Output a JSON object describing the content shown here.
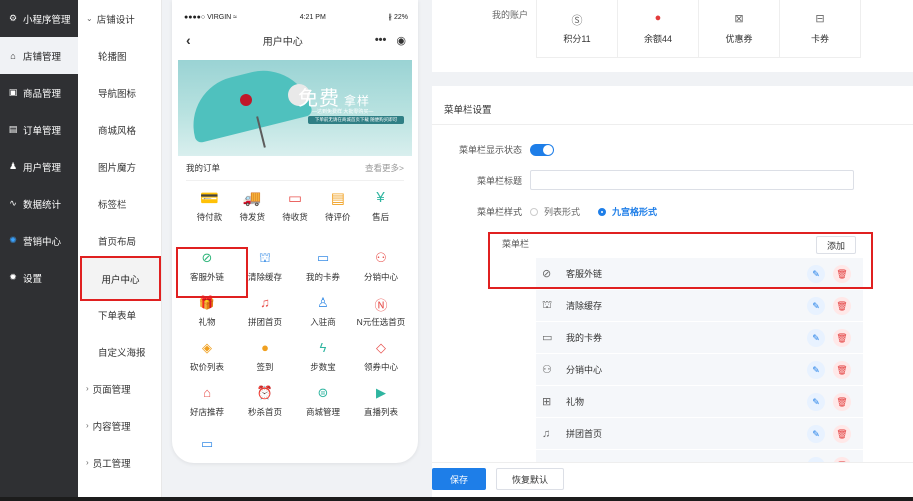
{
  "sidebar": {
    "items": [
      {
        "label": "小程序管理",
        "icon": "gear-icon",
        "glyph": "⚙"
      },
      {
        "label": "店铺管理",
        "icon": "store-icon",
        "glyph": "⌂"
      },
      {
        "label": "商品管理",
        "icon": "goods-icon",
        "glyph": "▣"
      },
      {
        "label": "订单管理",
        "icon": "order-icon",
        "glyph": "▤"
      },
      {
        "label": "用户管理",
        "icon": "user-icon",
        "glyph": "♟"
      },
      {
        "label": "数据统计",
        "icon": "chart-icon",
        "glyph": "∿"
      },
      {
        "label": "营销中心",
        "icon": "marketing-icon",
        "glyph": "✺"
      },
      {
        "label": "设置",
        "icon": "settings-icon",
        "glyph": "✹"
      }
    ]
  },
  "subnav": {
    "group": "店铺设计",
    "items": [
      "轮播图",
      "导航图标",
      "商城风格",
      "图片魔方",
      "标签栏",
      "首页布局",
      "用户中心",
      "下单表单",
      "自定义海报"
    ],
    "groups_after": [
      "页面管理",
      "内容管理",
      "员工管理"
    ]
  },
  "phone": {
    "status_left": "●●●●○ VIRGIN ≈",
    "status_time": "4:21 PM",
    "status_right": "∦ 22%",
    "title": "用户中心",
    "banner": {
      "title": "免费",
      "title_small": "拿样",
      "line1": "—达到免费样 大批零购买—",
      "line2": "下单前无请在商城首页下载 随便购买即可"
    },
    "orders": {
      "title": "我的订单",
      "more": "查看更多>",
      "items": [
        {
          "label": "待付款",
          "icon": "wallet-icon",
          "glyph": "💳",
          "color": "#2fb5a0"
        },
        {
          "label": "待发货",
          "icon": "truck-icon",
          "glyph": "🚚",
          "color": "#2fb5a0"
        },
        {
          "label": "待收货",
          "icon": "box-icon",
          "glyph": "▭",
          "color": "#e8534f"
        },
        {
          "label": "待评价",
          "icon": "comment-icon",
          "glyph": "▤",
          "color": "#f0a020"
        },
        {
          "label": "售后",
          "icon": "aftersale-icon",
          "glyph": "¥",
          "color": "#2fb5a0"
        }
      ]
    },
    "grid": [
      {
        "label": "客服外链",
        "icon": "link-icon",
        "glyph": "⊘",
        "color": "#2fb57a"
      },
      {
        "label": "清除缓存",
        "icon": "broom-icon",
        "glyph": "⛫",
        "color": "#3a8ee6"
      },
      {
        "label": "我的卡券",
        "icon": "card-icon",
        "glyph": "▭",
        "color": "#3a8ee6"
      },
      {
        "label": "分销中心",
        "icon": "distribution-icon",
        "glyph": "⚇",
        "color": "#e8534f"
      },
      {
        "label": "礼物",
        "icon": "gift-icon",
        "glyph": "🎁",
        "color": "#e8534f"
      },
      {
        "label": "拼团首页",
        "icon": "group-icon",
        "glyph": "♫",
        "color": "#e8534f"
      },
      {
        "label": "入驻商",
        "icon": "merchant-icon",
        "glyph": "♙",
        "color": "#3a8ee6"
      },
      {
        "label": "N元任选首页",
        "icon": "n-icon",
        "glyph": "Ⓝ",
        "color": "#e8534f"
      },
      {
        "label": "砍价列表",
        "icon": "bargain-icon",
        "glyph": "◈",
        "color": "#f0a020"
      },
      {
        "label": "签到",
        "icon": "signin-icon",
        "glyph": "●",
        "color": "#f0a020"
      },
      {
        "label": "步数宝",
        "icon": "steps-icon",
        "glyph": "ϟ",
        "color": "#2fb5a0"
      },
      {
        "label": "领券中心",
        "icon": "coupon-icon",
        "glyph": "◇",
        "color": "#e8534f"
      },
      {
        "label": "好店推荐",
        "icon": "shop-icon",
        "glyph": "⌂",
        "color": "#e8534f"
      },
      {
        "label": "秒杀首页",
        "icon": "clock-icon",
        "glyph": "⏰",
        "color": "#e8534f"
      },
      {
        "label": "商城管理",
        "icon": "mall-icon",
        "glyph": "⊜",
        "color": "#2fb5a0"
      },
      {
        "label": "直播列表",
        "icon": "live-icon",
        "glyph": "▶",
        "color": "#2fb5a0"
      },
      {
        "label": "",
        "icon": "more-icon",
        "glyph": "▭",
        "color": "#3a8ee6"
      }
    ]
  },
  "account": {
    "label": "我的账户",
    "items": [
      {
        "label": "积分11",
        "icon": "points-icon",
        "glyph": "Ⓢ"
      },
      {
        "label": "余额44",
        "icon": "balance-icon",
        "glyph": "●"
      },
      {
        "label": "优惠券",
        "icon": "coupon-icon",
        "glyph": "⊠"
      },
      {
        "label": "卡券",
        "icon": "card-icon",
        "glyph": "⊟"
      }
    ]
  },
  "menu_settings": {
    "section_title": "菜单栏设置",
    "show_label": "菜单栏显示状态",
    "title_label": "菜单栏标题",
    "style_label": "菜单栏样式",
    "style_options": [
      "列表形式",
      "九宫格形式"
    ],
    "menu_label": "菜单栏",
    "add_label": "添加",
    "rows": [
      {
        "label": "客服外链",
        "icon": "link-icon",
        "glyph": "⊘"
      },
      {
        "label": "清除缓存",
        "icon": "broom-icon",
        "glyph": "⛫"
      },
      {
        "label": "我的卡券",
        "icon": "card-icon",
        "glyph": "▭"
      },
      {
        "label": "分销中心",
        "icon": "distribution-icon",
        "glyph": "⚇"
      },
      {
        "label": "礼物",
        "icon": "gift-icon",
        "glyph": "⊞"
      },
      {
        "label": "拼团首页",
        "icon": "group-icon",
        "glyph": "♫"
      },
      {
        "label": "",
        "icon": "more-icon",
        "glyph": ""
      }
    ],
    "edit_glyph": "✎",
    "delete_glyph": "🗑"
  },
  "footer": {
    "save": "保存",
    "reset": "恢复默认"
  },
  "colors": {
    "accent": "#1e7ee8",
    "highlight": "#e02020",
    "sidebar_bg": "#2f3033"
  }
}
